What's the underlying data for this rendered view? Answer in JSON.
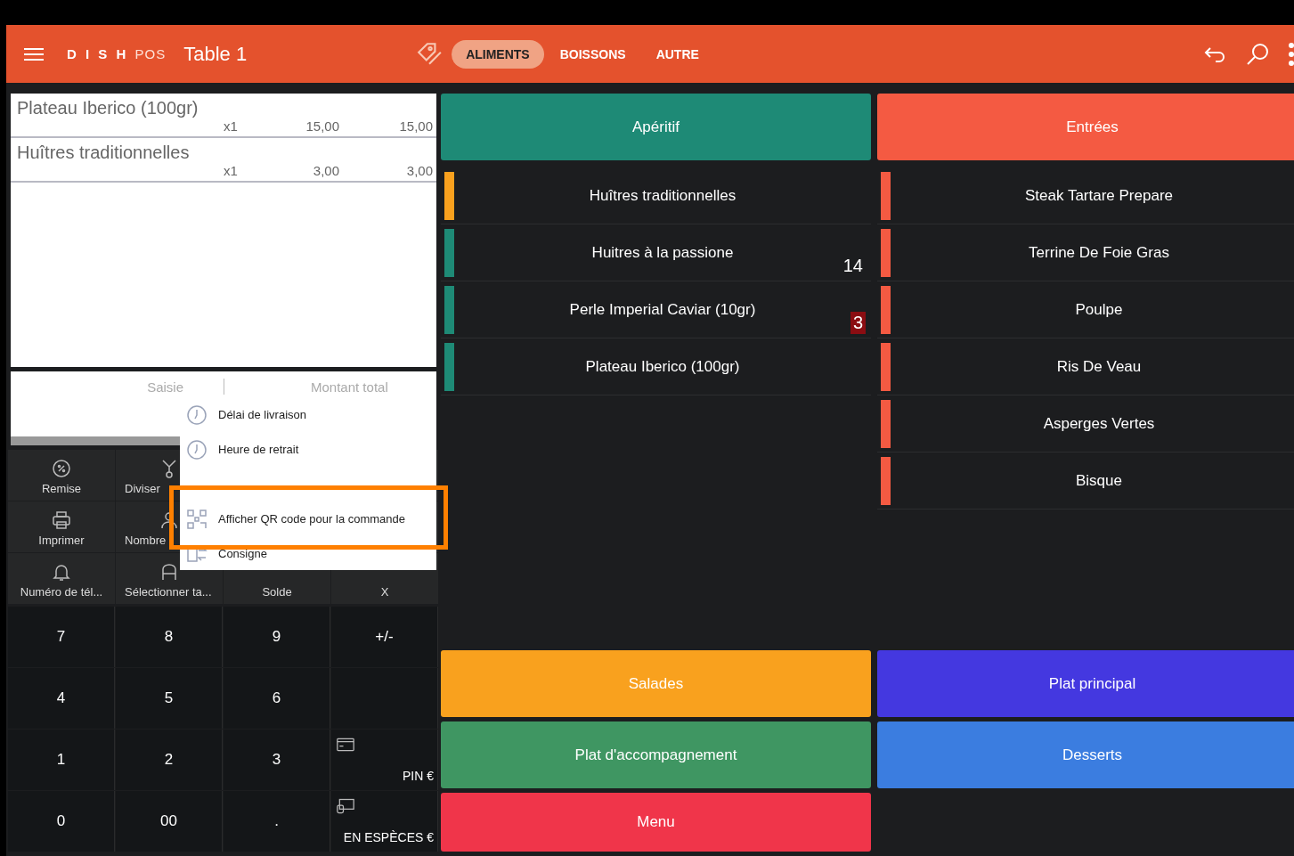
{
  "header": {
    "logo": {
      "brand": "D I S H",
      "suffix": "POS"
    },
    "title": "Table 1",
    "tabs": [
      {
        "label": "ALIMENTS",
        "selected": true
      },
      {
        "label": "BOISSONS",
        "selected": false
      },
      {
        "label": "AUTRE",
        "selected": false
      }
    ]
  },
  "order": {
    "items": [
      {
        "name": "Plateau Iberico (100gr)",
        "qty": "x1",
        "price": "15,00",
        "total": "15,00"
      },
      {
        "name": "Huîtres traditionnelles",
        "qty": "x1",
        "price": "3,00",
        "total": "3,00"
      }
    ],
    "totals": {
      "input_label": "Saisie",
      "total_label": "Montant total"
    }
  },
  "functions": [
    {
      "label": "Remise"
    },
    {
      "label": "Diviser"
    },
    {
      "label": "Imprimer"
    },
    {
      "label": "Nombre"
    },
    {
      "label": "Numéro de tél..."
    },
    {
      "label": "Sélectionner ta..."
    },
    {
      "label": "Solde"
    },
    {
      "label": "X"
    }
  ],
  "keypad": [
    {
      "label": "7",
      "kind": "key"
    },
    {
      "label": "8",
      "kind": "key"
    },
    {
      "label": "9",
      "kind": "key"
    },
    {
      "label": "+/-",
      "kind": "key"
    },
    {
      "label": "4",
      "kind": "key"
    },
    {
      "label": "5",
      "kind": "key"
    },
    {
      "label": "6",
      "kind": "key"
    },
    {
      "label": "1",
      "kind": "key"
    },
    {
      "label": "2",
      "kind": "key"
    },
    {
      "label": "3",
      "kind": "key"
    },
    {
      "label": "PIN €",
      "kind": "payment"
    },
    {
      "label": "0",
      "kind": "key"
    },
    {
      "label": "00",
      "kind": "key"
    },
    {
      "label": ".",
      "kind": "key"
    },
    {
      "label": "EN ESPÈCES €",
      "kind": "payment"
    }
  ],
  "popup_menu": {
    "items": [
      {
        "label": "Délai de livraison"
      },
      {
        "label": "Heure de retrait"
      },
      {
        "label": "Afficher QR code pour la commande"
      },
      {
        "label": "Consigne"
      }
    ]
  },
  "category_columns": [
    {
      "title": "Apéritif",
      "color": "#1e8a76",
      "items": [
        {
          "name": "Huîtres traditionnelles",
          "color": "#f9a11e"
        },
        {
          "name": "Huitres à la passione",
          "color": "#1e8a76",
          "badge": {
            "text": "14",
            "kind": "plain"
          }
        },
        {
          "name": "Perle Imperial Caviar (10gr)",
          "color": "#1e8a76",
          "badge": {
            "text": "3",
            "kind": "alert"
          }
        },
        {
          "name": "Plateau Iberico (100gr)",
          "color": "#1e8a76"
        }
      ]
    },
    {
      "title": "Entrées",
      "color": "#f45a42",
      "items": [
        {
          "name": "Steak Tartare Prepare",
          "color": "#f45a42"
        },
        {
          "name": "Terrine De Foie Gras",
          "color": "#f45a42"
        },
        {
          "name": "Poulpe",
          "color": "#f45a42"
        },
        {
          "name": "Ris De Veau",
          "color": "#f45a42"
        },
        {
          "name": "Asperges Vertes",
          "color": "#f45a42"
        },
        {
          "name": "Bisque",
          "color": "#f45a42"
        }
      ]
    }
  ],
  "categories": [
    {
      "label": "Salades",
      "color": "#f9a11e"
    },
    {
      "label": "Plat principal",
      "color": "#4438e0"
    },
    {
      "label": "Plat d'accompagnement",
      "color": "#3f9662"
    },
    {
      "label": "Desserts",
      "color": "#3b7de0"
    },
    {
      "label": "Menu",
      "color": "#f0354a"
    }
  ]
}
